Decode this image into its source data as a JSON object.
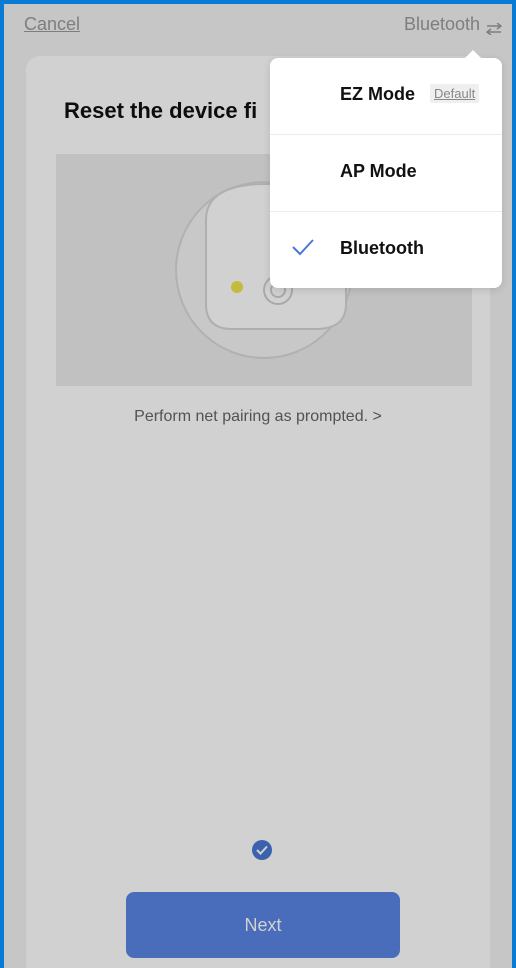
{
  "header": {
    "cancel_label": "Cancel",
    "mode_label": "Bluetooth"
  },
  "main": {
    "title": "Reset the device fi",
    "pairing_hint": "Perform net pairing as prompted. >",
    "next_label": "Next"
  },
  "dropdown": {
    "items": [
      {
        "label": "EZ Mode",
        "badge": "Default",
        "selected": false
      },
      {
        "label": "AP Mode",
        "selected": false
      },
      {
        "label": "Bluetooth",
        "selected": true
      }
    ]
  },
  "colors": {
    "accent": "#5b86e5",
    "frame_border": "#0a7bd4",
    "indicator_dot": "#f0e34c"
  }
}
